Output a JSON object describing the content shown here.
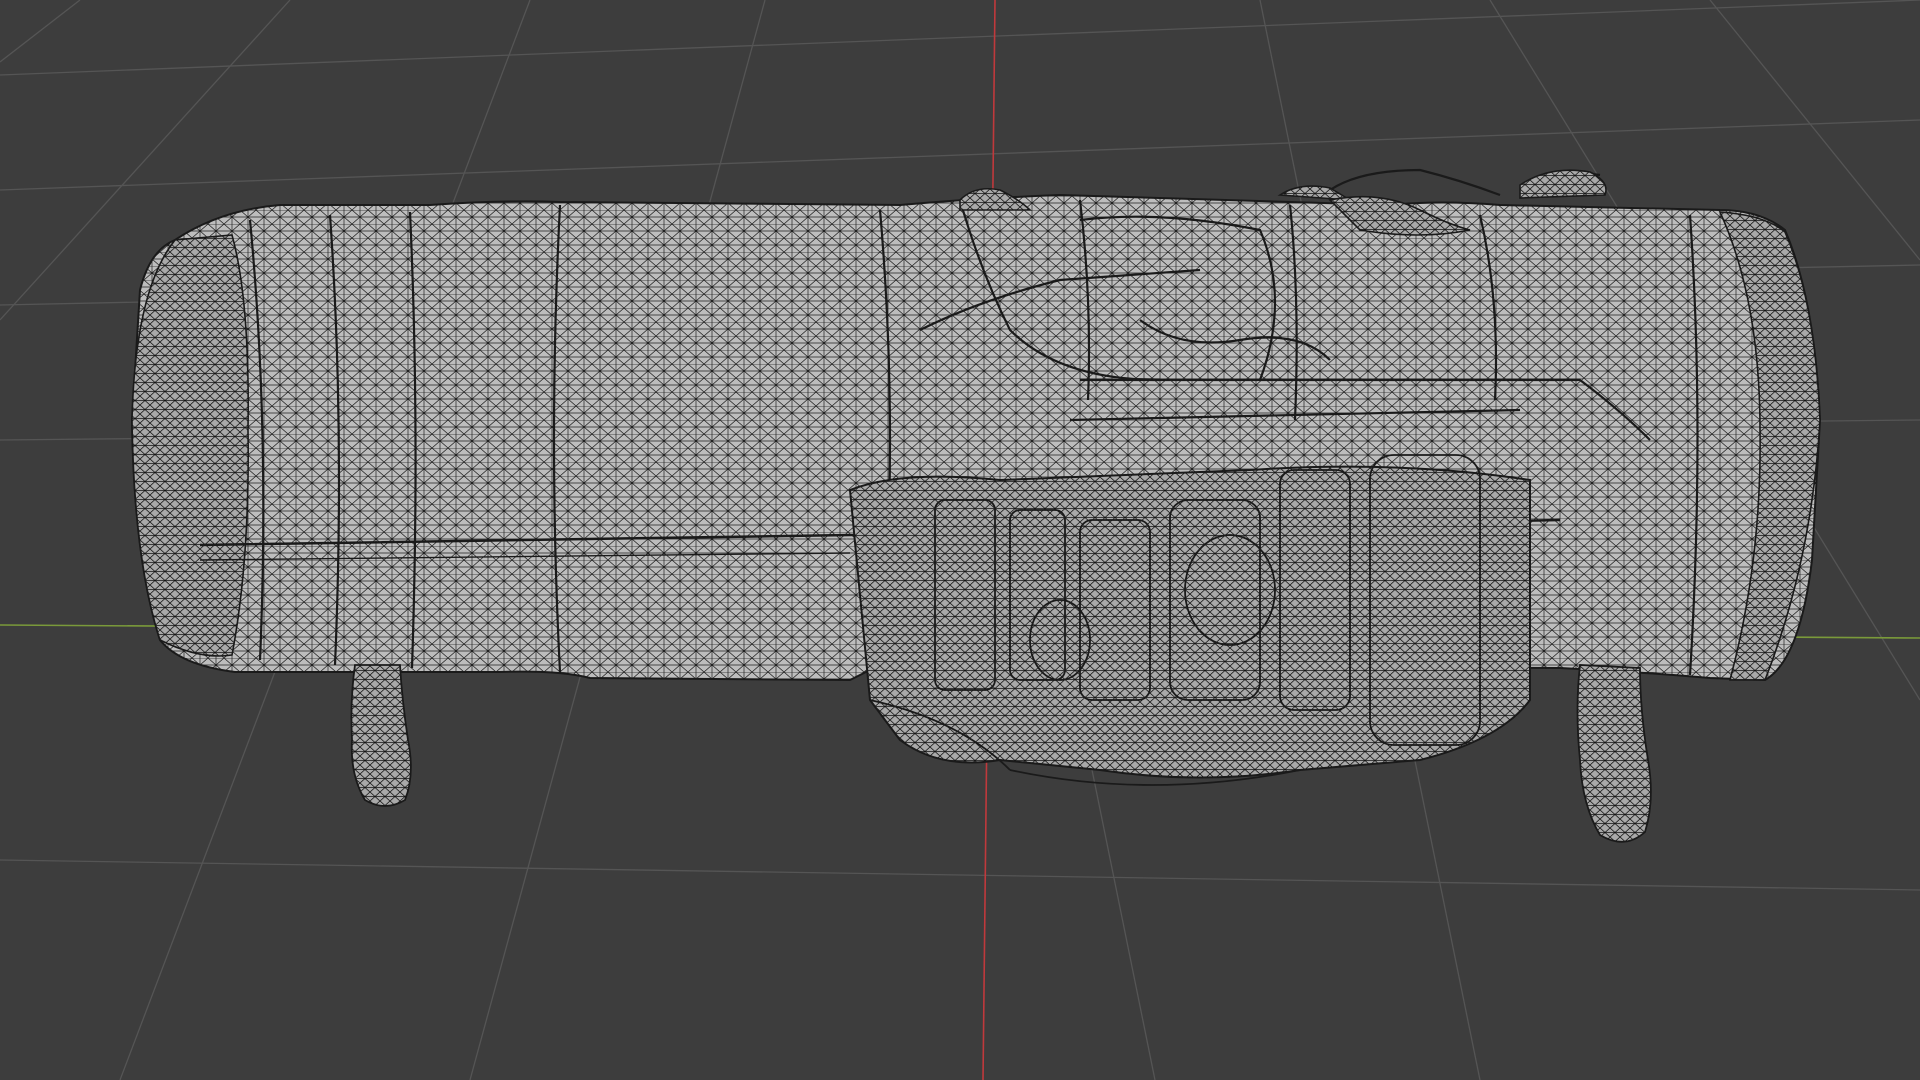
{
  "viewport": {
    "background": "#3d3d3d",
    "shading_mode": "wireframe",
    "grid_line_color": "#555555",
    "x_axis_color": "#7a9a3a",
    "y_axis_color": "#c0393c",
    "mesh_fill_color": "#bdbdbd",
    "mesh_wire_color": "#1a1a1a"
  },
  "object": {
    "icon": "jet-engine-mesh-icon"
  }
}
